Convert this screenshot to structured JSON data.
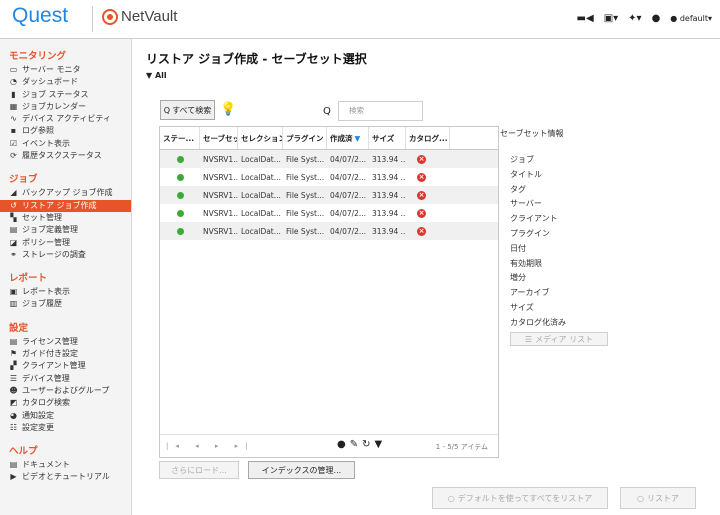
{
  "header": {
    "brand": "Quest",
    "product": "NetVault",
    "user": "default"
  },
  "sidebar": {
    "sections": [
      {
        "title": "モニタリング",
        "items": [
          {
            "label": "サーバー モニタ",
            "icon": "monitor-icon",
            "glyph": "▭"
          },
          {
            "label": "ダッシュボード",
            "icon": "dashboard-icon",
            "glyph": "◔"
          },
          {
            "label": "ジョブ ステータス",
            "icon": "job-status-icon",
            "glyph": "▮"
          },
          {
            "label": "ジョブカレンダー",
            "icon": "calendar-icon",
            "glyph": "▦"
          },
          {
            "label": "デバイス アクティビティ",
            "icon": "activity-icon",
            "glyph": "∿"
          },
          {
            "label": "ログ参照",
            "icon": "log-icon",
            "glyph": "▪"
          },
          {
            "label": "イベント表示",
            "icon": "event-icon",
            "glyph": "☑"
          },
          {
            "label": "履歴タスクステータス",
            "icon": "history-icon",
            "glyph": "⟳"
          }
        ]
      },
      {
        "title": "ジョブ",
        "items": [
          {
            "label": "バックアップ ジョブ作成",
            "icon": "backup-icon",
            "glyph": "◢"
          },
          {
            "label": "リストア ジョブ作成",
            "icon": "restore-icon",
            "glyph": "↺",
            "active": true
          },
          {
            "label": "セット管理",
            "icon": "sets-icon",
            "glyph": "▚"
          },
          {
            "label": "ジョブ定義管理",
            "icon": "job-definition-icon",
            "glyph": "▤"
          },
          {
            "label": "ポリシー管理",
            "icon": "policy-icon",
            "glyph": "◪"
          },
          {
            "label": "ストレージの調査",
            "icon": "storage-icon",
            "glyph": "⚭"
          }
        ]
      },
      {
        "title": "レポート",
        "items": [
          {
            "label": "レポート表示",
            "icon": "report-icon",
            "glyph": "▣"
          },
          {
            "label": "ジョブ履歴",
            "icon": "job-history-icon",
            "glyph": "▥"
          }
        ]
      },
      {
        "title": "設定",
        "items": [
          {
            "label": "ライセンス管理",
            "icon": "license-icon",
            "glyph": "▤"
          },
          {
            "label": "ガイド付き設定",
            "icon": "guided-icon",
            "glyph": "⚑"
          },
          {
            "label": "クライアント管理",
            "icon": "client-icon",
            "glyph": "▞"
          },
          {
            "label": "デバイス管理",
            "icon": "device-icon",
            "glyph": "☰"
          },
          {
            "label": "ユーザーおよびグループ",
            "icon": "users-icon",
            "glyph": "☻"
          },
          {
            "label": "カタログ検索",
            "icon": "catalog-icon",
            "glyph": "◩"
          },
          {
            "label": "通知設定",
            "icon": "notification-icon",
            "glyph": "◕"
          },
          {
            "label": "設定変更",
            "icon": "settings-icon",
            "glyph": "☷"
          }
        ]
      },
      {
        "title": "ヘルプ",
        "items": [
          {
            "label": "ドキュメント",
            "icon": "document-icon",
            "glyph": "▤"
          },
          {
            "label": "ビデオとチュートリアル",
            "icon": "video-icon",
            "glyph": "▶"
          }
        ]
      }
    ]
  },
  "main": {
    "title": "リストア ジョブ作成 - セーブセット選択",
    "filter": "All",
    "search_all_label": "すべて検索",
    "search_placeholder": "検索",
    "columns": [
      "ステー...",
      "セーブセット",
      "セレクション",
      "プラグイン",
      "作成済",
      "サイズ",
      "カタログ..."
    ],
    "rows": [
      [
        "",
        "NVSRV1...",
        "LocalDat...",
        "File Syst...",
        "04/07/2...",
        "313.94 ...",
        ""
      ],
      [
        "",
        "NVSRV1...",
        "LocalDat...",
        "File Syst...",
        "04/07/2...",
        "313.94 ...",
        ""
      ],
      [
        "",
        "NVSRV1...",
        "LocalDat...",
        "File Syst...",
        "04/07/2...",
        "313.94 ...",
        ""
      ],
      [
        "",
        "NVSRV1...",
        "LocalDat...",
        "File Syst...",
        "04/07/2...",
        "313.94 ...",
        ""
      ],
      [
        "",
        "NVSRV1...",
        "LocalDat...",
        "File Syst...",
        "04/07/2...",
        "313.94 ...",
        ""
      ]
    ],
    "item_count": "1 - 5/5 アイテム",
    "load_more_label": "さらにロード...",
    "manage_index_label": "インデックスの管理...",
    "restore_default_label": "デフォルトを使ってすべてをリストア",
    "restore_label": "リストア"
  },
  "saveset_info": {
    "title": "セーブセット情報",
    "fields": [
      "ジョブ",
      "タイトル",
      "タグ",
      "サーバー",
      "クライアント",
      "プラグイン",
      "日付",
      "有効期限",
      "増分",
      "アーカイブ",
      "サイズ",
      "カタログ化済み"
    ],
    "media_list_label": "メディア リスト"
  },
  "colors": {
    "accent": "#e8542a",
    "brand": "#1e88e5",
    "ok": "#3aaa35",
    "error": "#d9362c"
  }
}
